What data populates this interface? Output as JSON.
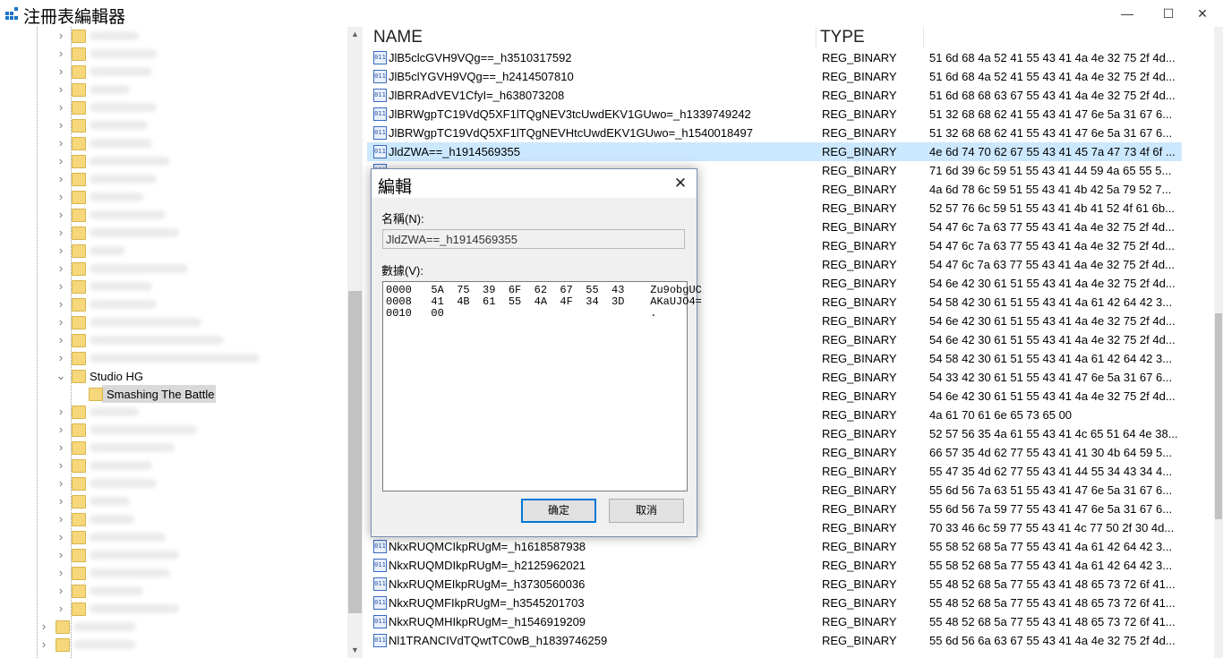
{
  "window": {
    "title": "注冊表編輯器",
    "minimize": "—",
    "maximize": "☐",
    "close": "✕"
  },
  "tree": {
    "expanded_label": "Studio HG",
    "selected_label": "Smashing The Battle"
  },
  "list": {
    "columns": [
      "NAME",
      "TYPE"
    ],
    "rows": [
      {
        "name": "JlB5clcGVH9VQg==_h3510317592",
        "type": "REG_BINARY",
        "data": "51 6d 68 4a 52 41 55 43 41 4a 4e 32 75 2f 4d..."
      },
      {
        "name": "JlB5clYGVH9VQg==_h2414507810",
        "type": "REG_BINARY",
        "data": "51 6d 68 4a 52 41 55 43 41 4a 4e 32 75 2f 4d..."
      },
      {
        "name": "JlBRRAdVEV1CfyI=_h638073208",
        "type": "REG_BINARY",
        "data": "51 6d 68 68 63 67 55 43 41 4a 4e 32 75 2f 4d..."
      },
      {
        "name": "JlBRWgpTC19VdQ5XF1lTQgNEV3tcUwdEKV1GUwo=_h1339749242",
        "type": "REG_BINARY",
        "data": "51 32 68 68 62 41 55 43 41 47 6e 5a 31 67 6..."
      },
      {
        "name": "JlBRWgpTC19VdQ5XF1lTQgNEVHtcUwdEKV1GUwo=_h1540018497",
        "type": "REG_BINARY",
        "data": "51 32 68 68 62 41 55 43 41 47 6e 5a 31 67 6..."
      },
      {
        "name": "JldZWA==_h1914569355",
        "type": "REG_BINARY",
        "data": "4e 6d 74 70 62 67 55 43 41 45 7a 47 73 4f 6f ..."
      },
      {
        "name": "",
        "type": "REG_BINARY",
        "data": "71 6d 39 6c 59 51 55 43 41 44 59 4a 65 55 5..."
      },
      {
        "name": "",
        "type": "REG_BINARY",
        "data": "4a 6d 78 6c 59 51 55 43 41 4b 42 5a 79 52 7..."
      },
      {
        "name": "",
        "type": "REG_BINARY",
        "data": "52 57 76 6c 59 51 55 43 41 4b 41 52 4f 61 6b..."
      },
      {
        "name": "",
        "type": "REG_BINARY",
        "data": "54 47 6c 7a 63 77 55 43 41 4a 4e 32 75 2f 4d..."
      },
      {
        "name": "",
        "type": "REG_BINARY",
        "data": "54 47 6c 7a 63 77 55 43 41 4a 4e 32 75 2f 4d..."
      },
      {
        "name": "",
        "type": "REG_BINARY",
        "data": "54 47 6c 7a 63 77 55 43 41 4a 4e 32 75 2f 4d..."
      },
      {
        "name": "",
        "type": "REG_BINARY",
        "data": "54 6e 42 30 61 51 55 43 41 4a 4e 32 75 2f 4d..."
      },
      {
        "name": "",
        "type": "REG_BINARY",
        "data": "54 58 42 30 61 51 55 43 41 4a 61 42 64 42 3..."
      },
      {
        "name": "",
        "type": "REG_BINARY",
        "data": "54 6e 42 30 61 51 55 43 41 4a 4e 32 75 2f 4d..."
      },
      {
        "name": "",
        "type": "REG_BINARY",
        "data": "54 6e 42 30 61 51 55 43 41 4a 4e 32 75 2f 4d..."
      },
      {
        "name": "",
        "type": "REG_BINARY",
        "data": "54 58 42 30 61 51 55 43 41 4a 61 42 64 42 3..."
      },
      {
        "name": "",
        "type": "REG_BINARY",
        "data": "54 33 42 30 61 51 55 43 41 47 6e 5a 31 67 6..."
      },
      {
        "name": "",
        "type": "REG_BINARY",
        "data": "54 6e 42 30 61 51 55 43 41 4a 4e 32 75 2f 4d..."
      },
      {
        "name": "",
        "type": "REG_BINARY",
        "data": "4a 61 70 61 6e 65 73 65 00"
      },
      {
        "name": "",
        "type": "REG_BINARY",
        "data": "52 57 56 35 4a 61 55 43 41 4c 65 51 64 4e 38..."
      },
      {
        "name": "",
        "type": "REG_BINARY",
        "data": "66 57 35 4d 62 77 55 43 41 41 30 4b 64 59 5..."
      },
      {
        "name": "",
        "type": "REG_BINARY",
        "data": "55 47 35 4d 62 77 55 43 41 44 55 34 43 34 4..."
      },
      {
        "name": "",
        "type": "REG_BINARY",
        "data": "55 6d 56 7a 63 51 55 43 41 47 6e 5a 31 67 6..."
      },
      {
        "name": "",
        "type": "REG_BINARY",
        "data": "55 6d 56 7a 59 77 55 43 41 47 6e 5a 31 67 6..."
      },
      {
        "name": "",
        "type": "REG_BINARY",
        "data": "70 33 46 6c 59 77 55 43 41 4c 77 50 2f 30 4d..."
      },
      {
        "name": "NkxRUQMCIkpRUgM=_h1618587938",
        "type": "REG_BINARY",
        "data": "55 58 52 68 5a 77 55 43 41 4a 61 42 64 42 3..."
      },
      {
        "name": "NkxRUQMDIkpRUgM=_h2125962021",
        "type": "REG_BINARY",
        "data": "55 58 52 68 5a 77 55 43 41 4a 61 42 64 42 3..."
      },
      {
        "name": "NkxRUQMEIkpRUgM=_h3730560036",
        "type": "REG_BINARY",
        "data": "55 48 52 68 5a 77 55 43 41 48 65 73 72 6f 41..."
      },
      {
        "name": "NkxRUQMFIkpRUgM=_h3545201703",
        "type": "REG_BINARY",
        "data": "55 48 52 68 5a 77 55 43 41 48 65 73 72 6f 41..."
      },
      {
        "name": "NkxRUQMHIkpRUgM=_h1546919209",
        "type": "REG_BINARY",
        "data": "55 48 52 68 5a 77 55 43 41 48 65 73 72 6f 41..."
      },
      {
        "name": "Nl1TRANCIVdTQwtTC0wB_h1839746259",
        "type": "REG_BINARY",
        "data": "55 6d 56 6a 63 67 55 43 41 4a 4e 32 75 2f 4d..."
      }
    ]
  },
  "dialog": {
    "title": "編輯",
    "close": "✕",
    "name_label": "名稱(N):",
    "name_value": "JldZWA==_h1914569355",
    "data_label": "數據(V):",
    "hex_lines": [
      "0000   5A  75  39  6F  62  67  55  43    Zu9obgUC",
      "0008   41  4B  61  55  4A  4F  34  3D    AKaUJO4=",
      "0010   00                                ."
    ],
    "ok_label": "确定",
    "cancel_label": "取消"
  }
}
